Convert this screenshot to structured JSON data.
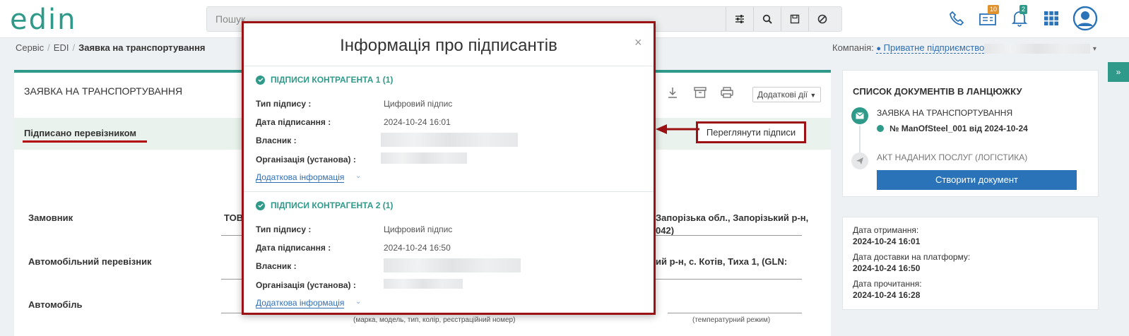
{
  "header": {
    "logo": "edin",
    "search_placeholder": "Пошук",
    "badges": {
      "documents": "10",
      "notifications": "2"
    }
  },
  "breadcrumbs": [
    "Сервіс",
    "EDI",
    "Заявка на транспортування"
  ],
  "company": {
    "label": "Компанія:",
    "value": "Приватне підприємство"
  },
  "main": {
    "title": "ЗАЯВКА НА ТРАНСПОРТУВАННЯ",
    "more_actions": "Додаткові дії",
    "status": "Підписано перевізником",
    "view_signatures": "Переглянути підписи",
    "fields": [
      {
        "label": "Замовник",
        "value_left": "ТОВ",
        "value_right": "Запорізька обл., Запорізький р-н,",
        "value_right2": "042)"
      },
      {
        "label": "Автомобільний перевізник",
        "value_right": "ий р-н, с. Котів, Тиха 1, (GLN:"
      },
      {
        "label": "Автомобіль"
      }
    ],
    "note_vehicle": "(марка, модель, тип, колір, реєстраційний номер)",
    "note_temp": "(температурний режим)"
  },
  "chain": {
    "title": "СПИСОК ДОКУМЕНТІВ В ЛАНЦЮЖКУ",
    "doc1_title": "ЗАЯВКА НА ТРАНСПОРТУВАННЯ",
    "doc1_sub": "№ ManOfSteel_001 від 2024-10-24",
    "doc2_title": "АКТ НАДАНИХ ПОСЛУГ (ЛОГІСТИКА)",
    "create_button": "Створити документ"
  },
  "dates": {
    "received_label": "Дата отримання:",
    "received": "2024-10-24 16:01",
    "delivered_label": "Дата доставки на платформу:",
    "delivered": "2024-10-24 16:50",
    "read_label": "Дата прочитання:",
    "read": "2024-10-24 16:28"
  },
  "modal": {
    "title": "Інформація про підписантів",
    "close": "×",
    "sections": [
      {
        "header": "ПІДПИСИ КОНТРАГЕНТА 1 (1)",
        "type_label": "Тип підпису :",
        "type": "Цифровий підпис",
        "date_label": "Дата підписання :",
        "date": "2024-10-24 16:01",
        "owner_label": "Власник :",
        "org_label": "Організація (установа) :",
        "more": "Додаткова інформація"
      },
      {
        "header": "ПІДПИСИ КОНТРАГЕНТА 2 (1)",
        "type_label": "Тип підпису :",
        "type": "Цифровий підпис",
        "date_label": "Дата підписання :",
        "date": "2024-10-24 16:50",
        "owner_label": "Власник :",
        "org_label": "Організація (установа) :",
        "more": "Додаткова інформація"
      }
    ]
  },
  "colors": {
    "accent": "#2f9a8a",
    "highlight": "#9b1114",
    "link": "#2f6fb3",
    "button": "#2a73b8"
  }
}
